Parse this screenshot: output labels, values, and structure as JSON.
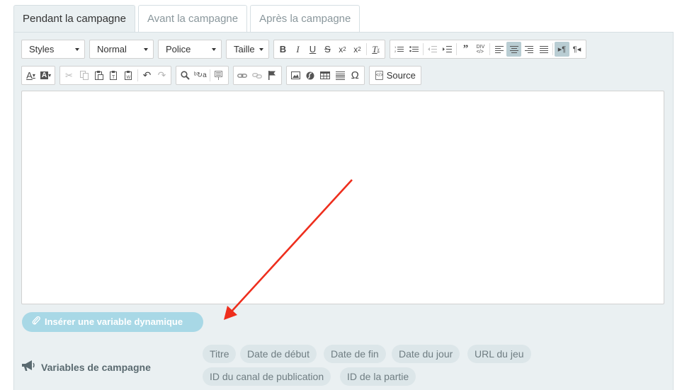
{
  "tabs": [
    {
      "label": "Pendant la campagne",
      "active": true
    },
    {
      "label": "Avant la campagne",
      "active": false
    },
    {
      "label": "Après la campagne",
      "active": false
    }
  ],
  "toolbar": {
    "styles": "Styles",
    "format": "Normal",
    "font": "Police",
    "size": "Taille",
    "source": "Source"
  },
  "insert_variable": "Insérer une variable dynamique",
  "variables": {
    "label": "Variables de campagne",
    "chips": [
      "Titre",
      "Date de début",
      "Date de fin",
      "Date du jour",
      "URL du jeu",
      "ID du canal de publication",
      "ID de la partie"
    ]
  },
  "colors": {
    "panel_bg": "#eaf0f2",
    "insert_button": "#a8d8e6",
    "annotation_arrow": "#ee2e1d"
  }
}
